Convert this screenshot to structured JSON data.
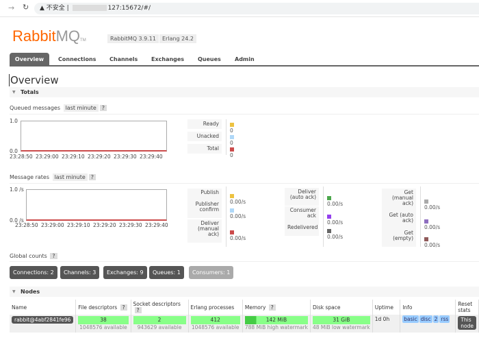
{
  "browser": {
    "security": "不安全",
    "url": "127:15672/#/"
  },
  "header": {
    "logo": "RabbitMQ",
    "logo_prefix": "Rabbit",
    "logo_suffix": "MQ",
    "tm": "TM",
    "version": "RabbitMQ 3.9.11",
    "erlang": "Erlang 24.2"
  },
  "tabs": [
    "Overview",
    "Connections",
    "Channels",
    "Exchanges",
    "Queues",
    "Admin"
  ],
  "page_title": "Overview",
  "totals": {
    "title": "Totals",
    "queued_label": "Queued messages",
    "queued_range": "last minute",
    "help": "?",
    "queued_y": [
      "1.0",
      "0.0"
    ],
    "x_ticks": [
      "23:28:50",
      "23:29:00",
      "23:29:10",
      "23:29:20",
      "23:29:30",
      "23:29:40"
    ],
    "queued_legend": [
      {
        "label": "Ready",
        "value": "0",
        "color": "#edc240"
      },
      {
        "label": "Unacked",
        "value": "0",
        "color": "#afd8f8"
      },
      {
        "label": "Total",
        "value": "0",
        "color": "#cb4b4b"
      }
    ],
    "rates_label": "Message rates",
    "rates_range": "last minute",
    "rates_y": [
      "1.0 /s",
      "0.0 /s"
    ],
    "rates_col1": [
      {
        "label": "Publish",
        "value": "0.00/s",
        "color": "#edc240"
      },
      {
        "label": "Publisher confirm",
        "value": "0.00/s",
        "color": "#afd8f8"
      },
      {
        "label": "Deliver (manual ack)",
        "value": "0.00/s",
        "color": "#cb4b4b"
      }
    ],
    "rates_col2": [
      {
        "label": "Deliver (auto ack)",
        "value": "0.00/s",
        "color": "#4da74d"
      },
      {
        "label": "Consumer ack",
        "value": "0.00/s",
        "color": "#9440ed"
      },
      {
        "label": "Redelivered",
        "value": "0.00/s",
        "color": "#666666"
      }
    ],
    "rates_col3": [
      {
        "label": "Get (manual ack)",
        "value": "0.00/s",
        "color": "#aaaaaa"
      },
      {
        "label": "Get (auto ack)",
        "value": "0.00/s",
        "color": "#8f6fc0"
      },
      {
        "label": "Get (empty)",
        "value": "0.00/s",
        "color": "#8f5a5a"
      }
    ]
  },
  "global": {
    "label": "Global counts",
    "help": "?",
    "buttons": [
      "Connections: 2",
      "Channels: 3",
      "Exchanges: 9",
      "Queues: 1",
      "Consumers: 1"
    ]
  },
  "nodes": {
    "title": "Nodes",
    "headers": [
      "Name",
      "File descriptors",
      "Socket descriptors",
      "Erlang processes",
      "Memory",
      "Disk space",
      "Uptime",
      "Info",
      "Reset stats"
    ],
    "row": {
      "name": "rabbit@4abf2841fe96",
      "fd": "38",
      "fd_avail": "1048576 available",
      "sd": "2",
      "sd_avail": "943629 available",
      "ep": "412",
      "ep_avail": "1048576 available",
      "mem": "142 MiB",
      "mem_wm": "788 MiB high watermark",
      "disk": "31 GiB",
      "disk_wm": "48 MiB low watermark",
      "uptime": "1d 0h",
      "info": [
        "basic",
        "disc",
        "2",
        "rss"
      ],
      "reset": "This node"
    }
  }
}
